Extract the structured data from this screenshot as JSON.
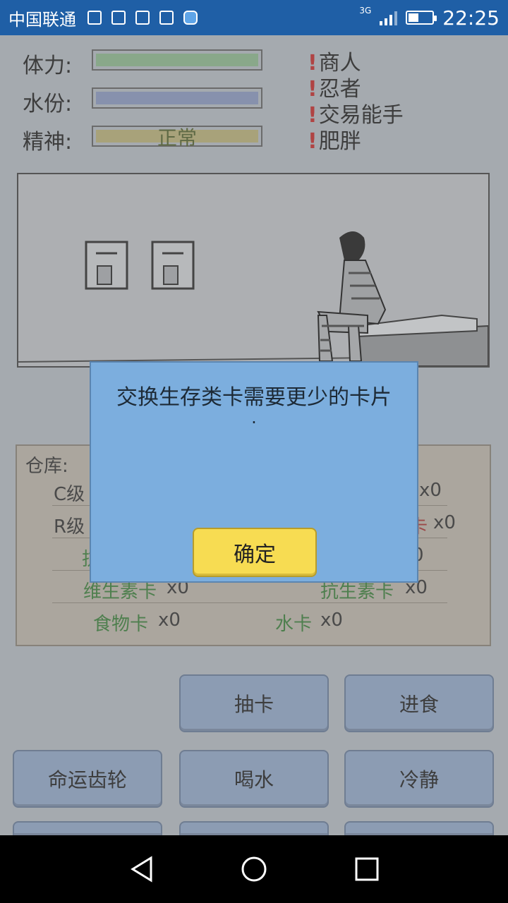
{
  "status_bar": {
    "carrier": "中国联通",
    "network": "3G",
    "time": "22:25",
    "icons": [
      "sim-icon",
      "image-icon",
      "keyboard-icon",
      "mail-icon",
      "sd-card-icon"
    ]
  },
  "stats": {
    "stamina_label": "体力:",
    "water_label": "水份:",
    "spirit_label": "精神:",
    "spirit_value": "正常",
    "colors": {
      "stamina": "#89a88a",
      "water": "#8791ad",
      "spirit": "#a8a27a"
    }
  },
  "traits": [
    {
      "mark": "!",
      "label": "商人"
    },
    {
      "mark": "!",
      "label": "忍者"
    },
    {
      "mark": "!",
      "label": "交易能手"
    },
    {
      "mark": "!",
      "label": "肥胖"
    }
  ],
  "warehouse": {
    "title": "仓库:",
    "c_label": "C级",
    "r_label": "R级",
    "c_count": "x0",
    "r_count": "x0",
    "r_card_fragment": "卡",
    "partial_left_1": "抗",
    "partial_right_1": "0",
    "vitamin_card": "维生素卡",
    "vitamin_count": "x0",
    "antibiotic_card": "抗生素卡",
    "antibiotic_count": "x0",
    "food_card": "食物卡",
    "food_count": "x0",
    "water_card": "水卡",
    "water_count": "x0"
  },
  "buttons": {
    "draw": "抽卡",
    "eat": "进食",
    "fate": "命运齿轮",
    "drink": "喝水",
    "calm": "冷静"
  },
  "dialog": {
    "message": "交换生存类卡需要更少的卡片",
    "dot": ".",
    "ok": "确定"
  }
}
